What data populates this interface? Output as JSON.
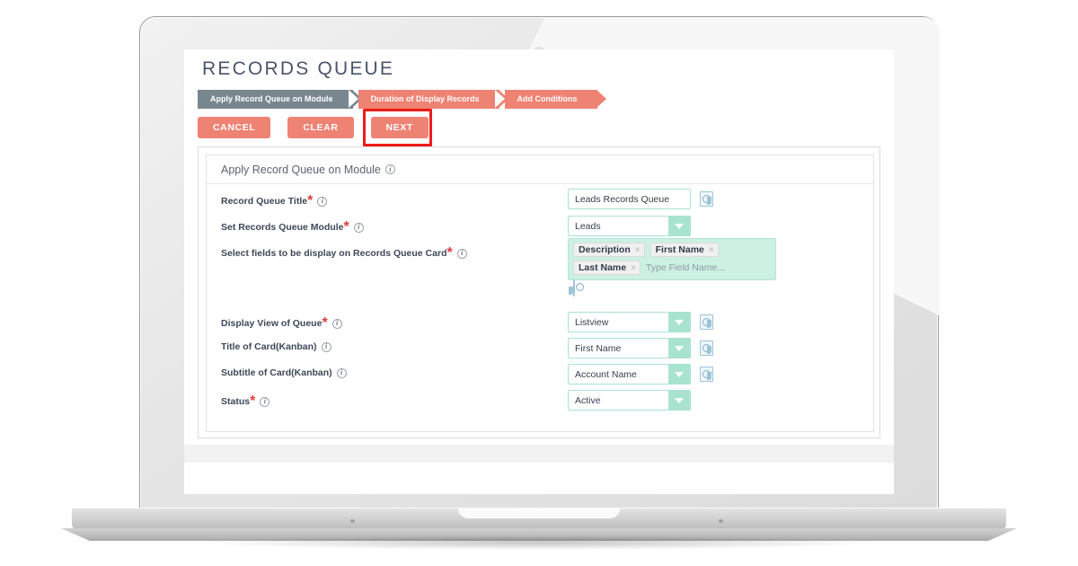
{
  "app": {
    "page_title": "RECORDS QUEUE",
    "steps": [
      {
        "label": "Apply Record Queue on Module",
        "state": "active"
      },
      {
        "label": "Duration of Display Records",
        "state": "pending"
      },
      {
        "label": "Add Conditions",
        "state": "pending"
      }
    ],
    "buttons": {
      "cancel": "CANCEL",
      "clear": "CLEAR",
      "next": "NEXT"
    },
    "highlight": {
      "target": "NEXT",
      "color": "#ee1b1b"
    },
    "panel": {
      "header": "Apply Record Queue on Module",
      "info_glyph": "i",
      "fields": [
        {
          "label": "Record Queue Title",
          "required": true,
          "control": "text",
          "value": "Leads Records Queue",
          "has_picker_icon": true
        },
        {
          "label": "Set Records Queue Module",
          "required": true,
          "control": "select",
          "value": "Leads",
          "has_picker_icon": false
        },
        {
          "label": "Select fields to be display on Records Queue Card",
          "required": true,
          "control": "multiselect",
          "tags": [
            "Description",
            "First Name",
            "Last Name"
          ],
          "placeholder": "Type Field Name...",
          "remove_glyph": "×",
          "has_picker_icon": true
        },
        {
          "label": "Display View of Queue",
          "required": true,
          "control": "select",
          "value": "Listview",
          "has_picker_icon": true
        },
        {
          "label": "Title of Card(Kanban)",
          "required": false,
          "control": "select",
          "value": "First Name",
          "has_picker_icon": true
        },
        {
          "label": "Subtitle of Card(Kanban)",
          "required": false,
          "control": "select",
          "value": "Account Name",
          "has_picker_icon": true
        },
        {
          "label": "Status",
          "required": true,
          "control": "select",
          "value": "Active",
          "has_picker_icon": false
        }
      ]
    },
    "colors": {
      "accent_coral": "#ee8273",
      "step_active": "#78868f",
      "field_mint": "#a8e3cf",
      "multiselect_bg": "#ccf0e2",
      "highlight_red": "#ee1b1b",
      "required_star": "#e03b3b"
    }
  }
}
